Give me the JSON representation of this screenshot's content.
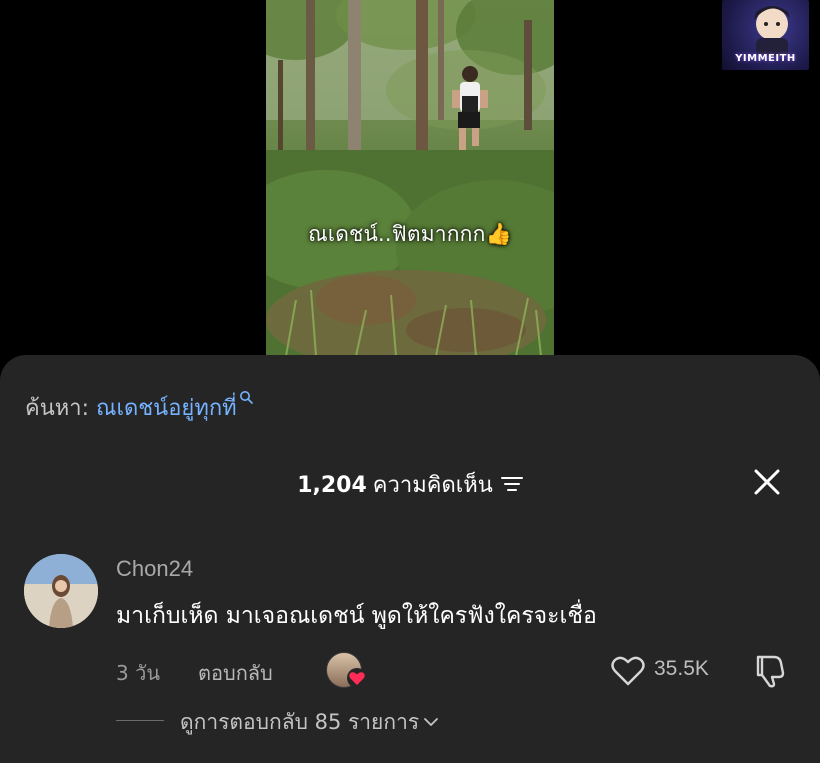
{
  "video": {
    "caption": "ณเดชน์..ฟิตมากกก👍",
    "channel_logo_text": "YIMMEITH"
  },
  "search": {
    "label": "ค้นหา:",
    "query": "ณเดชน์อยู่ทุกที่"
  },
  "comments_header": {
    "count": "1,204",
    "label": "ความคิดเห็น"
  },
  "comments": [
    {
      "username": "Chon24",
      "text": "มาเก็บเห็ด มาเจอณเดชน์ พูดให้ใครฟังใครจะเชื่อ",
      "time": "3 วัน",
      "reply_label": "ตอบกลับ",
      "likes": "35.5K",
      "view_replies": "ดูการตอบกลับ 85 รายการ"
    }
  ],
  "colors": {
    "sheet_background": "#252525",
    "search_query": "#75b2ff",
    "heart_badge": "#ff2d55",
    "text_primary": "#ffffff",
    "text_secondary": "#a9a9a9"
  },
  "icons": [
    "search-icon",
    "sort-icon",
    "close-icon",
    "heart-badge-icon",
    "like-icon",
    "dislike-icon",
    "chevron-down-icon"
  ]
}
